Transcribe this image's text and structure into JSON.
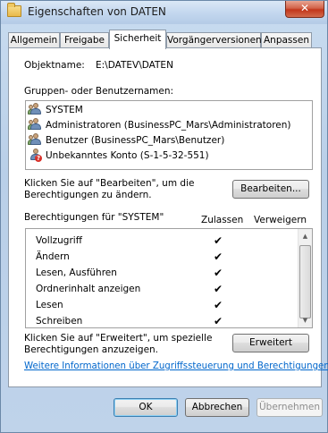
{
  "window": {
    "title": "Eigenschaften von DATEN",
    "close_symbol": "✕"
  },
  "tabs": [
    {
      "label": "Allgemein",
      "active": false
    },
    {
      "label": "Freigabe",
      "active": false
    },
    {
      "label": "Sicherheit",
      "active": true
    },
    {
      "label": "Vorgängerversionen",
      "active": false
    },
    {
      "label": "Anpassen",
      "active": false
    }
  ],
  "security": {
    "object_label": "Objektname:",
    "object_value": "E:\\DATEV\\DATEN",
    "groups_label": "Gruppen- oder Benutzernamen:",
    "groups": [
      {
        "name": "SYSTEM",
        "icon": "users-group-icon"
      },
      {
        "name": "Administratoren (BusinessPC_Mars\\Administratoren)",
        "icon": "users-group-icon"
      },
      {
        "name": "Benutzer (BusinessPC_Mars\\Benutzer)",
        "icon": "users-group-icon"
      },
      {
        "name": "Unbekanntes Konto (S-1-5-32-551)",
        "icon": "unknown-user-icon"
      }
    ],
    "edit_hint": "Klicken Sie auf \"Bearbeiten\", um die Berechtigungen zu ändern.",
    "edit_hint_line1": "Klicken Sie auf \"Bearbeiten\", um die",
    "edit_hint_line2": "Berechtigungen zu ändern.",
    "edit_button": "Bearbeiten...",
    "permissions_label": "Berechtigungen für \"SYSTEM\"",
    "allow_header": "Zulassen",
    "deny_header": "Verweigern",
    "permissions": [
      {
        "name": "Vollzugriff",
        "allow": "✔",
        "deny": ""
      },
      {
        "name": "Ändern",
        "allow": "✔",
        "deny": ""
      },
      {
        "name": "Lesen, Ausführen",
        "allow": "✔",
        "deny": ""
      },
      {
        "name": "Ordnerinhalt anzeigen",
        "allow": "✔",
        "deny": ""
      },
      {
        "name": "Lesen",
        "allow": "✔",
        "deny": ""
      },
      {
        "name": "Schreiben",
        "allow": "✔",
        "deny": ""
      }
    ],
    "advanced_hint_line1": "Klicken Sie auf \"Erweitert\", um spezielle",
    "advanced_hint_line2": "Berechtigungen anzuzeigen.",
    "advanced_button": "Erweitert",
    "info_link": "Weitere Informationen über Zugriffssteuerung und Berechtigungen"
  },
  "footer": {
    "ok": "OK",
    "cancel": "Abbrechen",
    "apply": "Übernehmen"
  },
  "colors": {
    "link": "#0066cc",
    "frame": "#c6d7ea",
    "close_button": "#c2361a"
  }
}
